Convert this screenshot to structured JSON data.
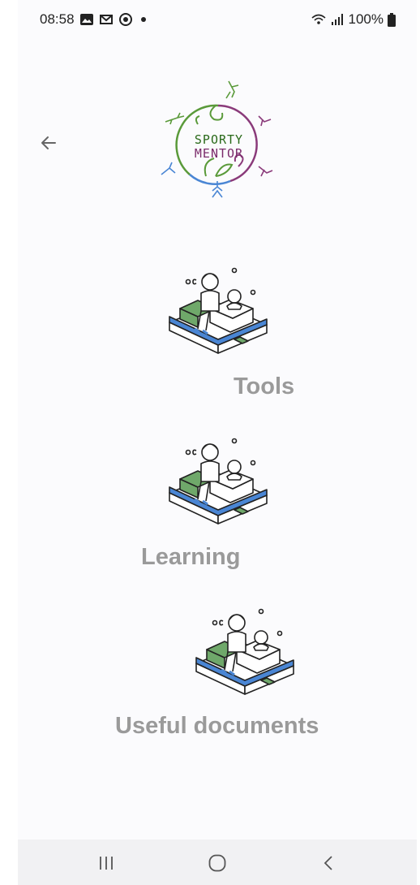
{
  "status_bar": {
    "time": "08:58",
    "battery": "100%"
  },
  "header": {
    "back_icon": "arrow-left-icon",
    "logo_text_line1": "SPORTY",
    "logo_text_line2": "MENTOR"
  },
  "menu": {
    "items": [
      {
        "label": "Tools",
        "icon": "person-on-sofa-illustration"
      },
      {
        "label": "Learning",
        "icon": "person-on-sofa-illustration"
      },
      {
        "label": "Useful documents",
        "icon": "person-on-sofa-illustration"
      }
    ]
  },
  "nav_bar": {
    "recent_icon": "recent-apps-icon",
    "home_icon": "home-icon",
    "back_icon": "back-chevron-icon"
  },
  "colors": {
    "label": "#9a9a9a",
    "blue": "#4a86d4",
    "green": "#6fa86a",
    "logo_green": "#5a9a3a",
    "logo_purple": "#8a3a7a"
  }
}
